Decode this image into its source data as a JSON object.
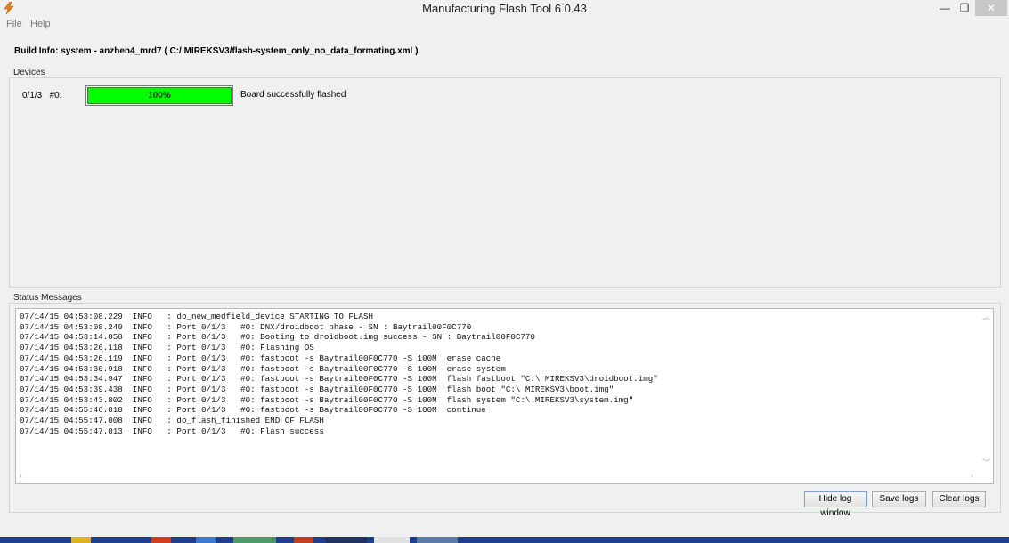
{
  "window": {
    "title": "Manufacturing Flash Tool 6.0.43",
    "minimize_glyph": "—",
    "maximize_glyph": "❐",
    "close_glyph": "✕"
  },
  "menu": {
    "file": "File",
    "help": "Help"
  },
  "build_info": "Build Info: system - anzhen4_mrd7 ( C:/ MIREKSV3/flash-system_only_no_data_formating.xml )",
  "devices": {
    "title": "Devices",
    "device_id": "0/1/3   #0:",
    "progress_label": "100%",
    "progress_value": 1.0,
    "status": "Board successfully flashed"
  },
  "status_messages": {
    "title": "Status Messages",
    "log": [
      "07/14/15 04:53:08.229  INFO   : do_new_medfield_device STARTING TO FLASH",
      "07/14/15 04:53:08.240  INFO   : Port 0/1/3   #0: DNX/droidboot phase - SN : Baytrail00F0C770",
      "07/14/15 04:53:14.858  INFO   : Port 0/1/3   #0: Booting to droidboot.img success - SN : Baytrail00F0C770",
      "07/14/15 04:53:26.118  INFO   : Port 0/1/3   #0: Flashing OS",
      "07/14/15 04:53:26.119  INFO   : Port 0/1/3   #0: fastboot -s Baytrail00F0C770 -S 100M  erase cache",
      "07/14/15 04:53:30.918  INFO   : Port 0/1/3   #0: fastboot -s Baytrail00F0C770 -S 100M  erase system",
      "07/14/15 04:53:34.947  INFO   : Port 0/1/3   #0: fastboot -s Baytrail00F0C770 -S 100M  flash fastboot \"C:\\ MIREKSV3\\droidboot.img\"",
      "07/14/15 04:53:39.438  INFO   : Port 0/1/3   #0: fastboot -s Baytrail00F0C770 -S 100M  flash boot \"C:\\ MIREKSV3\\boot.img\"",
      "07/14/15 04:53:43.802  INFO   : Port 0/1/3   #0: fastboot -s Baytrail00F0C770 -S 100M  flash system \"C:\\ MIREKSV3\\system.img\"",
      "07/14/15 04:55:46.010  INFO   : Port 0/1/3   #0: fastboot -s Baytrail00F0C770 -S 100M  continue",
      "07/14/15 04:55:47.008  INFO   : do_flash_finished END OF FLASH",
      "07/14/15 04:55:47.013  INFO   : Port 0/1/3   #0: Flash success"
    ]
  },
  "buttons": {
    "hide_log": "Hide log window",
    "save_logs": "Save logs",
    "clear_logs": "Clear logs"
  },
  "colors": {
    "progress_fill": "#00ff00",
    "taskbar": "#1e3f8e"
  }
}
